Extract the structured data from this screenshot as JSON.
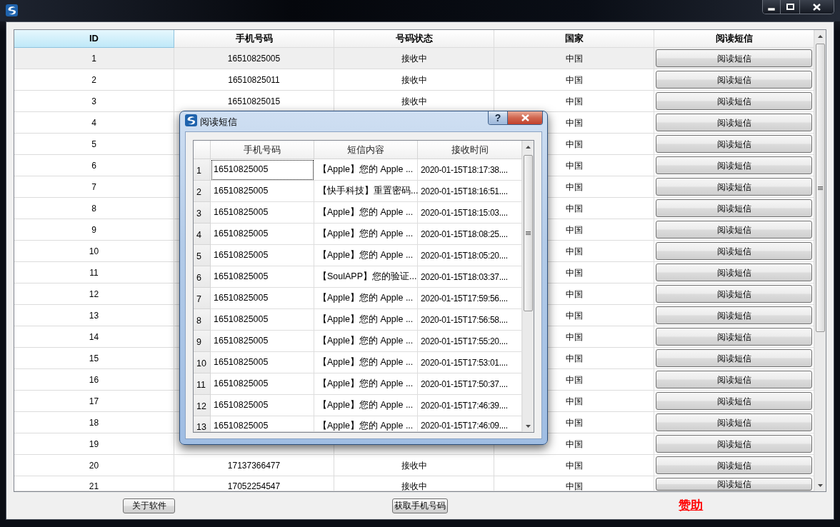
{
  "main_window": {
    "table": {
      "columns": [
        {
          "label": "ID",
          "selected": true
        },
        {
          "label": "手机号码",
          "selected": false
        },
        {
          "label": "号码状态",
          "selected": false
        },
        {
          "label": "国家",
          "selected": false
        },
        {
          "label": "阅读短信",
          "selected": false
        }
      ],
      "rows": [
        {
          "id": "1",
          "phone": "16510825005",
          "status": "接收中",
          "country": "中国",
          "action": "阅读短信",
          "selected": true
        },
        {
          "id": "2",
          "phone": "16510825011",
          "status": "接收中",
          "country": "中国",
          "action": "阅读短信",
          "selected": false
        },
        {
          "id": "3",
          "phone": "16510825015",
          "status": "接收中",
          "country": "中国",
          "action": "阅读短信",
          "selected": false
        },
        {
          "id": "4",
          "country": "中国",
          "action": "阅读短信",
          "selected": false
        },
        {
          "id": "5",
          "country": "中国",
          "action": "阅读短信",
          "selected": false
        },
        {
          "id": "6",
          "country": "中国",
          "action": "阅读短信",
          "selected": false
        },
        {
          "id": "7",
          "country": "中国",
          "action": "阅读短信",
          "selected": false
        },
        {
          "id": "8",
          "country": "中国",
          "action": "阅读短信",
          "selected": false
        },
        {
          "id": "9",
          "country": "中国",
          "action": "阅读短信",
          "selected": false
        },
        {
          "id": "10",
          "country": "中国",
          "action": "阅读短信",
          "selected": false
        },
        {
          "id": "11",
          "country": "中国",
          "action": "阅读短信",
          "selected": false
        },
        {
          "id": "12",
          "country": "中国",
          "action": "阅读短信",
          "selected": false
        },
        {
          "id": "13",
          "country": "中国",
          "action": "阅读短信",
          "selected": false
        },
        {
          "id": "14",
          "country": "中国",
          "action": "阅读短信",
          "selected": false
        },
        {
          "id": "15",
          "country": "中国",
          "action": "阅读短信",
          "selected": false
        },
        {
          "id": "16",
          "country": "中国",
          "action": "阅读短信",
          "selected": false
        },
        {
          "id": "17",
          "country": "中国",
          "action": "阅读短信",
          "selected": false
        },
        {
          "id": "18",
          "country": "中国",
          "action": "阅读短信",
          "selected": false
        },
        {
          "id": "19",
          "country": "中国",
          "action": "阅读短信",
          "selected": false
        },
        {
          "id": "20",
          "phone": "17137366477",
          "status": "接收中",
          "country": "中国",
          "action": "阅读短信",
          "selected": false
        },
        {
          "id": "21",
          "phone": "17052254547",
          "status": "接收中",
          "country": "中国",
          "action": "阅读短信",
          "selected": false
        }
      ]
    },
    "about_button": "关于软件",
    "get_number_button": "获取手机号码",
    "sponsor_link": "赞助"
  },
  "dialog": {
    "title": "阅读短信",
    "help_button": "?",
    "table": {
      "columns": [
        "手机号码",
        "短信内容",
        "接收时间"
      ],
      "rows": [
        {
          "number": "1",
          "phone": "16510825005",
          "content": "【Apple】您的 Apple ...",
          "time": "2020-01-15T18:17:38....",
          "focused": true
        },
        {
          "number": "2",
          "phone": "16510825005",
          "content": "【快手科技】重置密码...",
          "time": "2020-01-15T18:16:51....",
          "focused": false
        },
        {
          "number": "3",
          "phone": "16510825005",
          "content": "【Apple】您的 Apple ...",
          "time": "2020-01-15T18:15:03....",
          "focused": false
        },
        {
          "number": "4",
          "phone": "16510825005",
          "content": "【Apple】您的 Apple ...",
          "time": "2020-01-15T18:08:25....",
          "focused": false
        },
        {
          "number": "5",
          "phone": "16510825005",
          "content": "【Apple】您的 Apple ...",
          "time": "2020-01-15T18:05:20....",
          "focused": false
        },
        {
          "number": "6",
          "phone": "16510825005",
          "content": "【SoulAPP】您的验证...",
          "time": "2020-01-15T18:03:37....",
          "focused": false
        },
        {
          "number": "7",
          "phone": "16510825005",
          "content": "【Apple】您的 Apple ...",
          "time": "2020-01-15T17:59:56....",
          "focused": false
        },
        {
          "number": "8",
          "phone": "16510825005",
          "content": "【Apple】您的 Apple ...",
          "time": "2020-01-15T17:56:58....",
          "focused": false
        },
        {
          "number": "9",
          "phone": "16510825005",
          "content": "【Apple】您的 Apple ...",
          "time": "2020-01-15T17:55:20....",
          "focused": false
        },
        {
          "number": "10",
          "phone": "16510825005",
          "content": "【Apple】您的 Apple ...",
          "time": "2020-01-15T17:53:01....",
          "focused": false
        },
        {
          "number": "11",
          "phone": "16510825005",
          "content": "【Apple】您的 Apple ...",
          "time": "2020-01-15T17:50:37....",
          "focused": false
        },
        {
          "number": "12",
          "phone": "16510825005",
          "content": "【Apple】您的 Apple ...",
          "time": "2020-01-15T17:46:39....",
          "focused": false
        },
        {
          "number": "13",
          "phone": "16510825005",
          "content": "【Apple】您的 Apple ...",
          "time": "2020-01-15T17:46:09....",
          "focused": false
        }
      ]
    }
  }
}
